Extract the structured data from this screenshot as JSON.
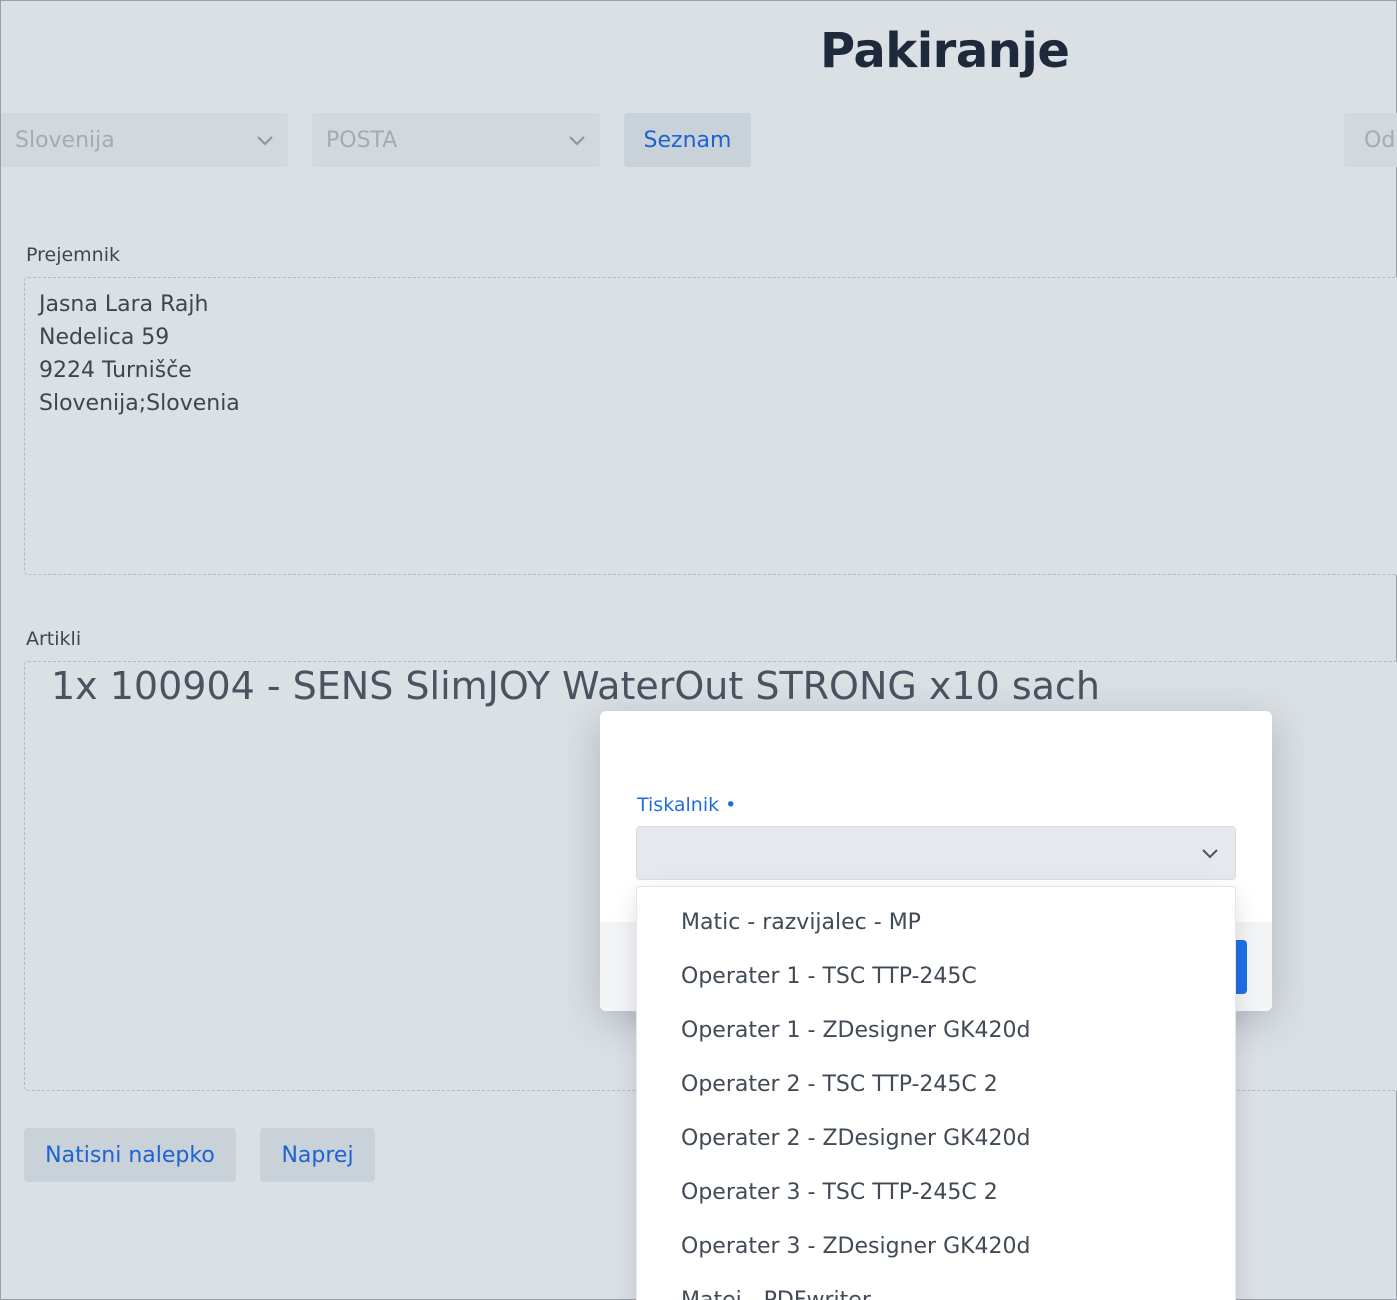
{
  "header": {
    "title": "Pakiranje"
  },
  "toolbar": {
    "country_select": {
      "value": "Slovenija"
    },
    "carrier_select": {
      "value": "POSTA"
    },
    "list_button": "Seznam",
    "right_button_partial": "Od"
  },
  "recipient": {
    "label": "Prejemnik",
    "lines": [
      "Jasna Lara Rajh",
      "Nedelica 59",
      "9224 Turnišče",
      "Slovenija;Slovenia"
    ]
  },
  "articles": {
    "label": "Artikli",
    "text": "1x 100904 - SENS SlimJOY WaterOut STRONG x10 sach"
  },
  "actions": {
    "print_label": "Natisni nalepko",
    "next": "Naprej"
  },
  "modal": {
    "printer_label": "Tiskalnik •",
    "printer_value": "",
    "options": [
      "Matic - razvijalec - MP",
      "Operater 1 - TSC TTP-245C",
      "Operater 1 - ZDesigner GK420d",
      "Operater 2 - TSC TTP-245C 2",
      "Operater 2 - ZDesigner GK420d",
      "Operater 3 - TSC TTP-245C 2",
      "Operater 3 - ZDesigner GK420d",
      "Matej - PDFwriter"
    ]
  },
  "colors": {
    "background": "#dbe0e5",
    "accent": "#1d63d1",
    "primary_button": "#1f6fe5"
  },
  "icons": {
    "select_chevron": "chevron-down-icon"
  }
}
